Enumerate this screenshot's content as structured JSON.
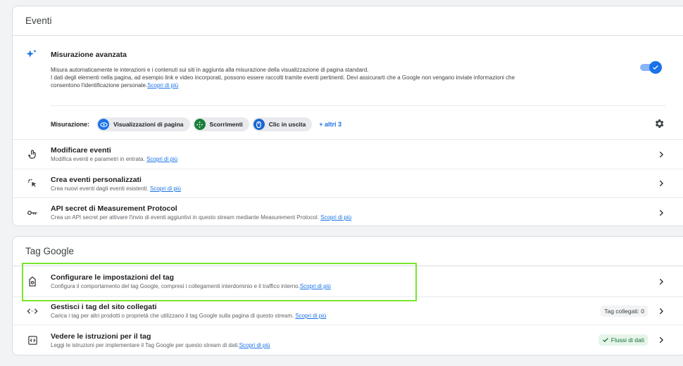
{
  "eventi": {
    "header": "Eventi",
    "misurazione": {
      "title": "Misurazione avanzata",
      "desc_line1": "Misura automaticamente le interazioni e i contenuti sui siti in aggiunta alla misurazione della visualizzazione di pagina standard.",
      "desc_line2": "I dati degli elementi nella pagina, ad esempio link e video incorporati, possono essere raccolti tramite eventi pertinenti. Devi assicurarti che a Google non vengano inviate informazioni che",
      "desc_line3": "consentono l'identificazione personale.",
      "link": "Scopri di più",
      "toggle_on": true,
      "measure_label": "Misurazione:",
      "chips": [
        {
          "label": "Visualizzazioni di pagina",
          "icon": "eye-icon",
          "color": "#1a73e8"
        },
        {
          "label": "Scorrimenti",
          "icon": "move-icon",
          "color": "#188038"
        },
        {
          "label": "Clic in uscita",
          "icon": "mouse-icon",
          "color": "#1967d2"
        }
      ],
      "more": "+ altri 3"
    },
    "rows": [
      {
        "title": "Modificare eventi",
        "sub": "Modifica eventi e parametri in entrata.",
        "link": "Scopri di più",
        "icon": "touch-icon"
      },
      {
        "title": "Crea eventi personalizzati",
        "sub": "Crea nuovi eventi dagli eventi esistenti.",
        "link": "Scopri di più",
        "icon": "sparkle-click-icon"
      },
      {
        "title": "API secret di Measurement Protocol",
        "sub": "Crea un API secret per attivare l'invio di eventi aggiuntivi in questo stream mediante Measurement Protocol.",
        "link": "Scopri di più",
        "icon": "key-icon"
      }
    ]
  },
  "tag": {
    "header": "Tag Google",
    "rows": [
      {
        "title": "Configurare le impostazioni del tag",
        "sub": "Configura il comportamento del tag Google, compresi i collegamenti interdominio e il traffico interno.",
        "link": "Scopri di più",
        "icon": "tag-icon"
      },
      {
        "title": "Gestisci i tag del sito collegati",
        "sub": "Carica i tag per altri prodotti o proprietà che utilizzano il tag Google sulla pagina di questo stream.",
        "link": "Scopri di più",
        "icon": "code-icon",
        "badge": "Tag collegati: 0"
      },
      {
        "title": "Vedere le istruzioni per il tag",
        "sub": "Leggi le istruzioni per implementare il Tag Google per questo stream di dati.",
        "link": "Scopri di più",
        "icon": "code-box-icon",
        "badge": "Flussi di dati"
      }
    ]
  },
  "colors": {
    "accent": "#1a73e8",
    "success": "#188038",
    "highlight": "#7ae62c"
  }
}
